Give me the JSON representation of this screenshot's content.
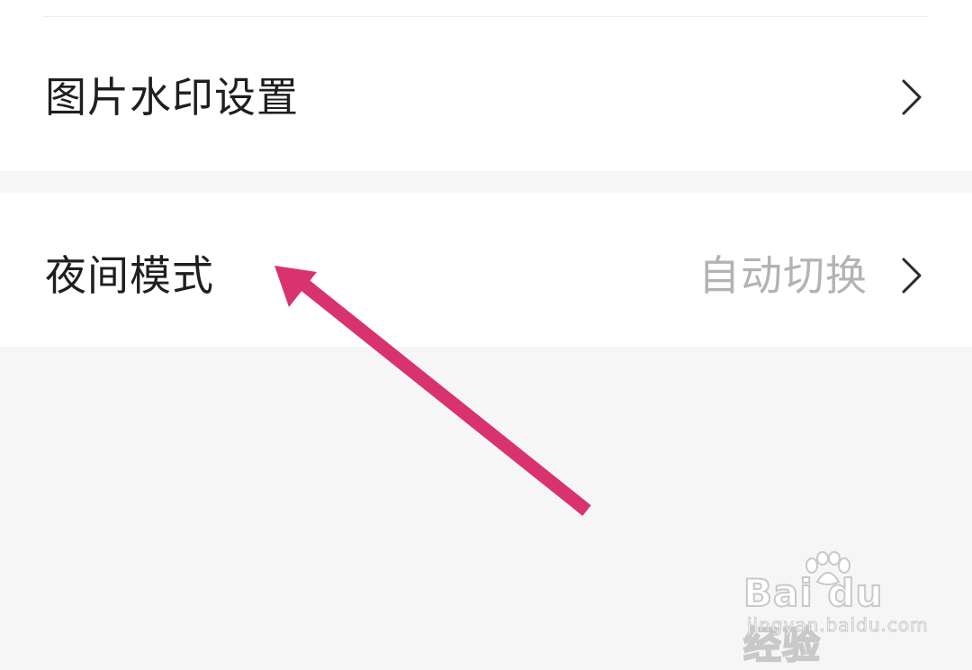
{
  "settings": {
    "watermark_row": {
      "label": "图片水印设置"
    },
    "night_mode_row": {
      "label": "夜间模式",
      "value": "自动切换"
    }
  },
  "watermark": {
    "logo_text": "Bai du 经验",
    "url": "jingyan.baidu.com"
  },
  "colors": {
    "background": "#f6f6f6",
    "section": "#ffffff",
    "label_text": "#1f1f1f",
    "value_text": "#b3b3b3",
    "annotation_arrow": "#d9336f"
  },
  "icons": {
    "chevron": "chevron-right-icon",
    "annotation": "pointer-arrow-icon"
  }
}
